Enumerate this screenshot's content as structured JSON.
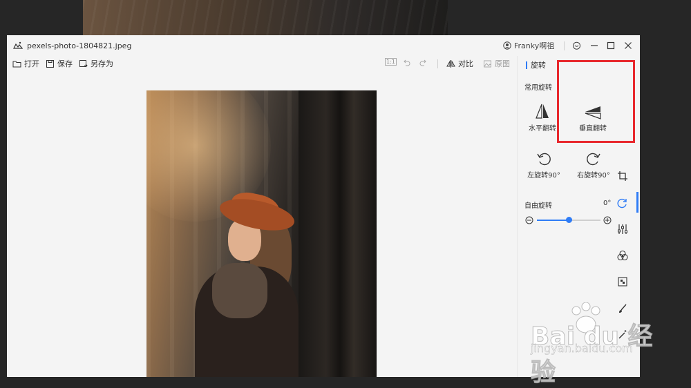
{
  "window": {
    "title": "pexels-photo-1804821.jpeg",
    "user_name": "Franky啊祖"
  },
  "toolbar": {
    "open_label": "打开",
    "save_label": "保存",
    "save_as_label": "另存为",
    "fit_label": "1:1",
    "compare_label": "对比",
    "original_label": "原图"
  },
  "panel": {
    "tab_label": "旋转",
    "common_label": "常用旋转",
    "flip_h_label": "水平翻转",
    "flip_v_label": "垂直翻转",
    "rotate_left_label": "左旋转90°",
    "rotate_right_label": "右旋转90°",
    "free_rotate_label": "自由旋转",
    "free_rotate_value": "0°",
    "slider_level": 0.5
  },
  "watermark": {
    "brand": "Bai du 经验",
    "url": "jingyan.baidu.com"
  },
  "colors": {
    "accent": "#2f7cf6",
    "highlight": "#e8282d"
  }
}
